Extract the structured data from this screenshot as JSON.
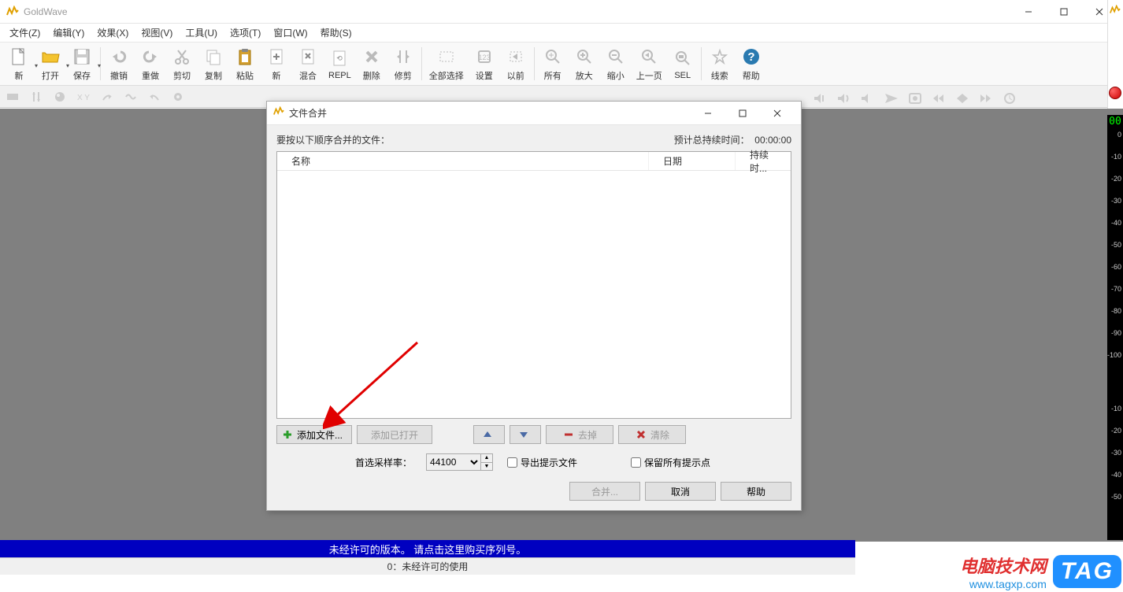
{
  "app": {
    "title": "GoldWave"
  },
  "window_controls": {
    "minimize": "—",
    "maximize": "☐",
    "close": "✕"
  },
  "menu": {
    "file": "文件(Z)",
    "edit": "编辑(Y)",
    "effect": "效果(X)",
    "view": "视图(V)",
    "tool": "工具(U)",
    "options": "选项(T)",
    "window": "窗口(W)",
    "help": "帮助(S)"
  },
  "toolbar": {
    "new": "新",
    "open": "打开",
    "save": "保存",
    "undo": "撤销",
    "redo": "重做",
    "cut": "剪切",
    "copy": "复制",
    "paste": "粘贴",
    "new2": "新",
    "mix": "混合",
    "repl": "REPL",
    "delete": "删除",
    "trim": "修剪",
    "selall": "全部选择",
    "set": "设置",
    "prev": "以前",
    "all": "所有",
    "zoomin": "放大",
    "zoomout": "缩小",
    "prevpg": "上一页",
    "sel": "SEL",
    "cue": "线索",
    "help": "帮助"
  },
  "dialog": {
    "title": "文件合并",
    "prompt": "要按以下顺序合并的文件：",
    "duration_label": "预计总持续时间：",
    "duration_value": "00:00:00",
    "col_name": "名称",
    "col_date": "日期",
    "col_duration": "持续时...",
    "add_files": "添加文件...",
    "add_open": "添加已打开",
    "remove": "去掉",
    "clear": "清除",
    "sample_rate_label": "首选采样率：",
    "sample_rate_value": "44100",
    "export_cue": "导出提示文件",
    "keep_cue": "保留所有提示点",
    "merge": "合并...",
    "cancel": "取消",
    "help": "帮助"
  },
  "meter": {
    "zero": "00",
    "ticks": [
      "0",
      "-10",
      "-20",
      "-30",
      "-40",
      "-50",
      "-60",
      "-70",
      "-80",
      "-90",
      "-100",
      "-10",
      "-20",
      "-30",
      "-40",
      "-50"
    ]
  },
  "bluebar": {
    "text": "未经许可的版本。  请点击这里购买序列号。"
  },
  "statusbar": {
    "text": "0：未经许可的使用"
  },
  "watermark": {
    "red": "电脑技术网",
    "blue": "www.tagxp.com",
    "tag": "TAG"
  }
}
